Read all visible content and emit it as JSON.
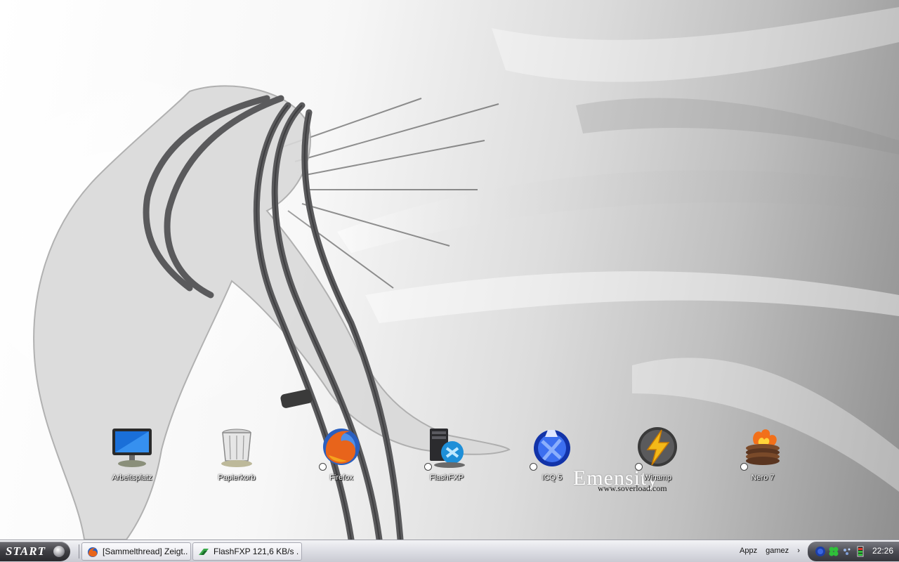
{
  "desktop": {
    "watermark": "Emensity",
    "watermark_url": "www.soverload.com",
    "icons": [
      {
        "label": "Arbeitsplatz",
        "icon": "monitor-icon",
        "shortcut": false
      },
      {
        "label": "Papierkorb",
        "icon": "recycle-bin-icon",
        "shortcut": false
      },
      {
        "label": "Firefox",
        "icon": "firefox-icon",
        "shortcut": true
      },
      {
        "label": "FlashFXP",
        "icon": "flashfxp-icon",
        "shortcut": true
      },
      {
        "label": "ICQ 5",
        "icon": "icq-icon",
        "shortcut": true
      },
      {
        "label": "Winamp",
        "icon": "winamp-icon",
        "shortcut": true
      },
      {
        "label": "Nero 7",
        "icon": "nero-icon",
        "shortcut": true
      }
    ]
  },
  "taskbar": {
    "start_label": "START",
    "tasks": [
      {
        "label": "[Sammelthread] Zeigt...",
        "icon": "firefox-icon"
      },
      {
        "label": "FlashFXP 121,6 KB/s ...",
        "icon": "flashfxp-icon"
      }
    ],
    "quicklinks": [
      "Appz",
      "gamez"
    ],
    "quicklinks_arrow": "›",
    "tray_icons": [
      "network-icon",
      "clover-icon",
      "sparkle-icon",
      "battery-icon"
    ],
    "clock": "22:26"
  },
  "colors": {
    "taskbar_bg": "#dfe0e6",
    "start_bg": "#3e3e43",
    "tray_bg": "#4c4d54"
  }
}
